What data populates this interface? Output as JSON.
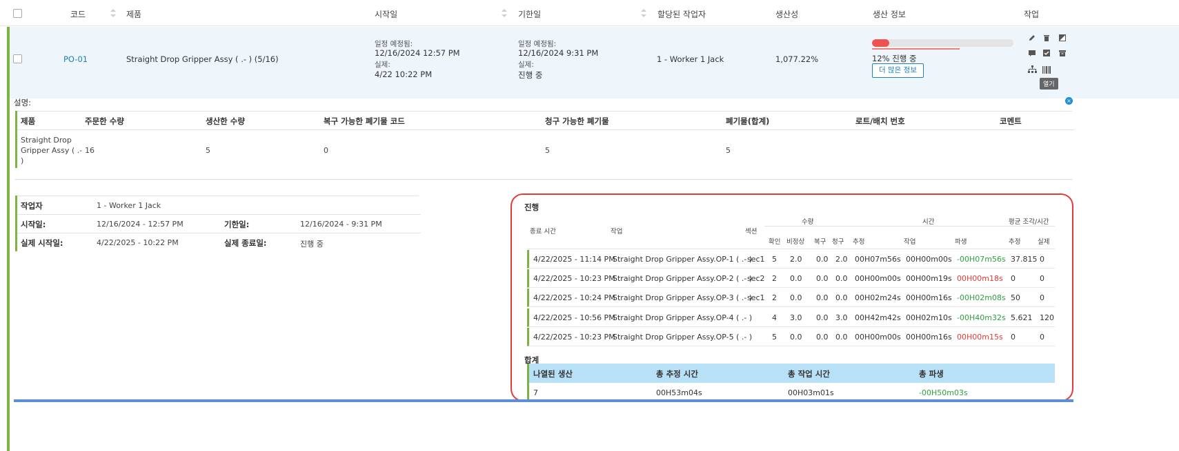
{
  "header": {
    "code": "코드",
    "product": "제품",
    "start_date": "시작일",
    "due_date": "기한일",
    "assigned_worker": "할당된 작업자",
    "productivity": "생산성",
    "production_info": "생산 정보",
    "action": "작업"
  },
  "row": {
    "code": "PO-01",
    "product": "Straight Drop Gripper Assy ( .- ) (5/16)",
    "start": {
      "planned_label": "일정 예정됨:",
      "planned": "12/16/2024   12:57 PM",
      "actual_label": "실제:",
      "actual": "4/22   10:22 PM"
    },
    "due": {
      "planned_label": "일정 예정됨:",
      "planned": "12/16/2024   9:31 PM",
      "actual_label": "실제:",
      "actual": "진행 중"
    },
    "worker": "1 - Worker 1 Jack",
    "productivity": "1,077.22%",
    "progress_percent": 12,
    "progress_text": "12% 진행 중",
    "more_button": "더 많은 정보",
    "tooltip": "열기",
    "action_icons": [
      "pencil-icon",
      "trash-icon",
      "chart-icon",
      "comment-icon",
      "check-icon",
      "archive-icon",
      "hierarchy-icon",
      "barcode-icon"
    ]
  },
  "description": {
    "title": "설명:",
    "headers": [
      "제품",
      "주문한 수량",
      "생산한 수량",
      "복구 가능한 폐기물 코드",
      "청구 가능한 폐기물",
      "폐기물(합계)",
      "로트/배치 번호",
      "코멘트"
    ],
    "product_line1": "Straight Drop",
    "product_line2": "Gripper Assy ( .-",
    "product_line3": ")",
    "ordered": "16",
    "produced": "5",
    "recoverable": "0",
    "billable": "5",
    "total_waste": "5",
    "lot": "",
    "comment": ""
  },
  "worker_info": {
    "worker_label": "작업자",
    "worker": "1 - Worker 1 Jack",
    "start_label": "시작일:",
    "start": "12/16/2024 - 12:57 PM",
    "due_label": "기한일:",
    "due": "12/16/2024 - 9:31 PM",
    "actual_start_label": "실제 시작일:",
    "actual_start": "4/22/2025 - 10:22 PM",
    "actual_end_label": "실제 종료일:",
    "actual_end": "진행 중"
  },
  "progress_panel": {
    "title": "진행",
    "headers": {
      "end_time": "종료 시간",
      "operation": "작업",
      "section": "섹션",
      "quantity": "수량",
      "time": "시간",
      "avg_piece_time": "평균 조각/시간",
      "confirm": "확인",
      "abnormal": "비정상",
      "recovery": "복구",
      "claim": "청구",
      "estimate": "추정",
      "work": "작업",
      "deviation": "파생",
      "avg_estimate": "추정",
      "avg_actual": "실제"
    },
    "rows": [
      {
        "end_time": "4/22/2025 - 11:14 PM",
        "operation": "Straight Drop Gripper Assy.OP-1 ( .- )",
        "section": "sec1",
        "confirm": "5",
        "abnormal": "2.0",
        "recovery": "0.0",
        "claim": "2.0",
        "estimate": "00H07m56s",
        "work": "00H00m00s",
        "deviation": "-00H07m56s",
        "deviation_color": "green",
        "avg_est": "37.815",
        "avg_act": "0"
      },
      {
        "end_time": "4/22/2025 - 10:23 PM",
        "operation": "Straight Drop Gripper Assy.OP-2 ( .- )",
        "section": "sec2",
        "confirm": "2",
        "abnormal": "0.0",
        "recovery": "0.0",
        "claim": "0.0",
        "estimate": "00H00m00s",
        "work": "00H00m19s",
        "deviation": "00H00m18s",
        "deviation_color": "red",
        "avg_est": "0",
        "avg_act": "0"
      },
      {
        "end_time": "4/22/2025 - 10:24 PM",
        "operation": "Straight Drop Gripper Assy.OP-3 ( .- )",
        "section": "sec1",
        "confirm": "2",
        "abnormal": "0.0",
        "recovery": "0.0",
        "claim": "0.0",
        "estimate": "00H02m24s",
        "work": "00H00m16s",
        "deviation": "-00H02m08s",
        "deviation_color": "green",
        "avg_est": "50",
        "avg_act": "0"
      },
      {
        "end_time": "4/22/2025 - 10:56 PM",
        "operation": "Straight Drop Gripper Assy.OP-4 ( .- )",
        "section": "",
        "confirm": "4",
        "abnormal": "3.0",
        "recovery": "0.0",
        "claim": "3.0",
        "estimate": "00H42m42s",
        "work": "00H02m10s",
        "deviation": "-00H40m32s",
        "deviation_color": "green",
        "avg_est": "5.621",
        "avg_act": "120"
      },
      {
        "end_time": "4/22/2025 - 10:23 PM",
        "operation": "Straight Drop Gripper Assy.OP-5 ( .- )",
        "section": "",
        "confirm": "5",
        "abnormal": "0.0",
        "recovery": "0.0",
        "claim": "0.0",
        "estimate": "00H00m00s",
        "work": "00H00m16s",
        "deviation": "00H00m15s",
        "deviation_color": "red",
        "avg_est": "0",
        "avg_act": "0"
      }
    ],
    "total_title": "합계",
    "total_headers": [
      "나열된 생산",
      "총 추정 시간",
      "총 작업 시간",
      "총 파생"
    ],
    "totals": {
      "listed": "7",
      "est_time": "00H53m04s",
      "work_time": "00H03m01s",
      "deviation": "-00H50m03s"
    }
  },
  "colors": {
    "accent_green": "#7cb342",
    "link_blue": "#1f7fc0",
    "highlight_red": "#e53935",
    "total_header_bg": "#b8e0f7",
    "bottom_line": "#5b8fd6"
  }
}
